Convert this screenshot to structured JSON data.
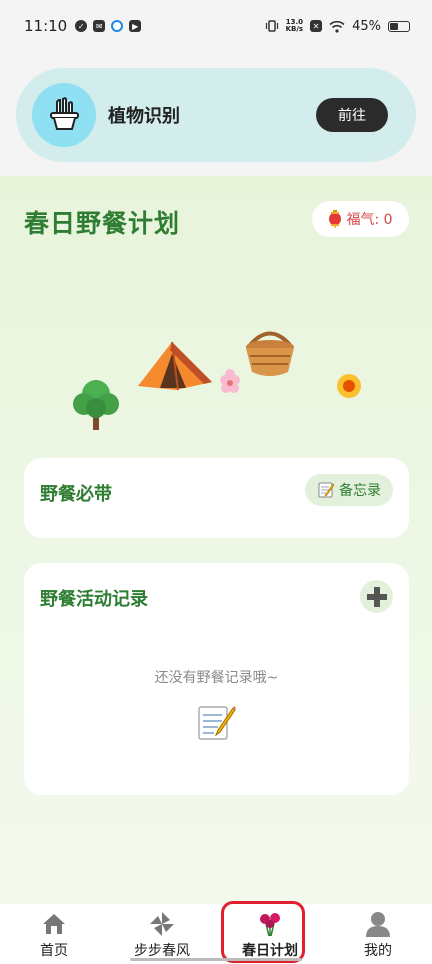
{
  "status_bar": {
    "time": "11:10",
    "net_speed_value": "13.0",
    "net_speed_unit": "KB/s",
    "battery": "45%"
  },
  "plant_card": {
    "title": "植物识别",
    "go_label": "前往"
  },
  "header": {
    "title": "春日野餐计划",
    "luck_label": "福气: 0"
  },
  "essentials": {
    "heading": "野餐必带",
    "memo_label": "备忘录"
  },
  "records": {
    "heading": "野餐活动记录",
    "empty_text": "还没有野餐记录哦~"
  },
  "nav": {
    "items": [
      {
        "label": "首页",
        "icon": "home-icon"
      },
      {
        "label": "步步春风",
        "icon": "pinwheel-icon"
      },
      {
        "label": "春日计划",
        "icon": "flowers-icon",
        "active": true
      },
      {
        "label": "我的",
        "icon": "profile-icon"
      }
    ]
  },
  "colors": {
    "accent_green": "#2e7d32",
    "active_highlight": "#e0202c"
  }
}
